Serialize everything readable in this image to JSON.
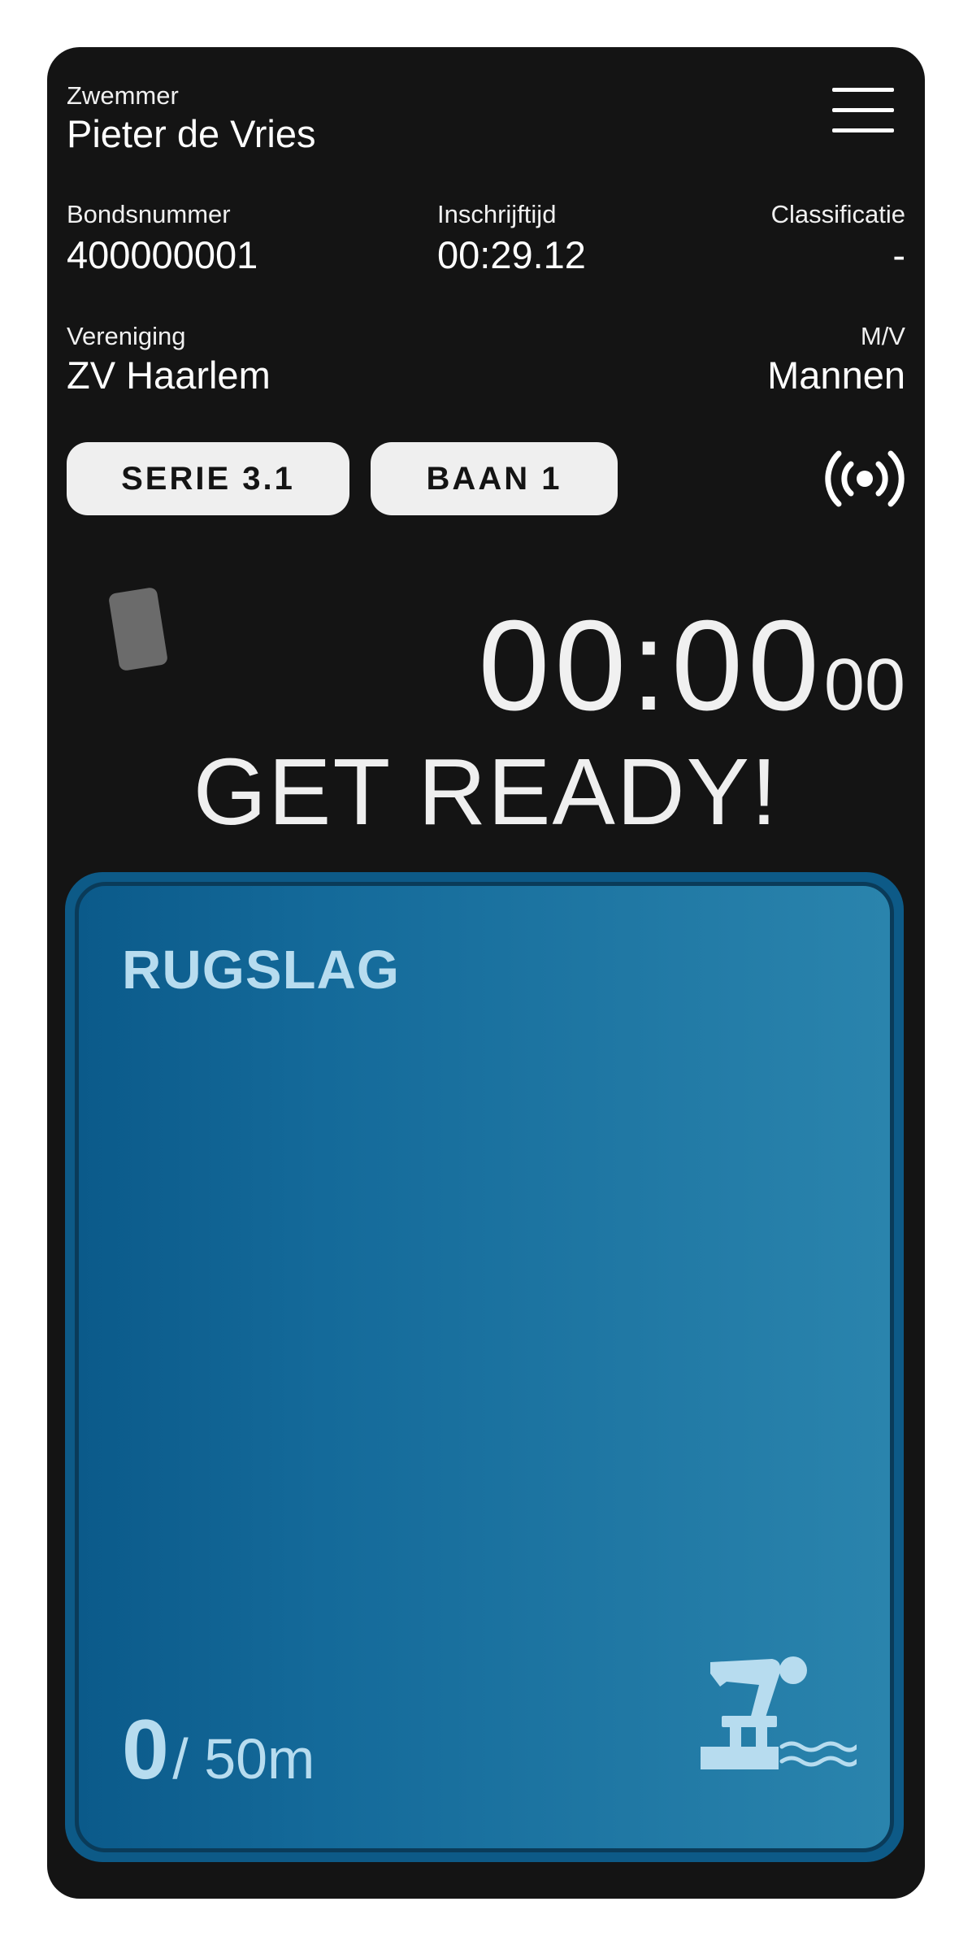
{
  "swimmer": {
    "label": "Zwemmer",
    "name": "Pieter de Vries"
  },
  "details": {
    "bond_label": "Bondsnummer",
    "bond_value": "400000001",
    "entry_label": "Inschrijftijd",
    "entry_value": "00:29.12",
    "class_label": "Classificatie",
    "class_value": "-",
    "club_label": "Vereniging",
    "club_value": "ZV Haarlem",
    "gender_label": "M/V",
    "gender_value": "Mannen"
  },
  "heat": {
    "serie_label": "SERIE 3.1",
    "lane_label": "BAAN 1"
  },
  "timer": {
    "main": "00:00",
    "hundredths": "00"
  },
  "status": "GET READY!",
  "race": {
    "stroke": "RUGSLAG",
    "lengths_done": "0",
    "distance": "/ 50m"
  },
  "icons": [
    "menu-icon",
    "broadcast-signal-icon",
    "card-icon",
    "swimmer-start-block-icon"
  ],
  "colors": {
    "background": "#141414",
    "panel": "#0d5a87",
    "panel_text": "#b7dcef",
    "pill": "#efefef"
  }
}
